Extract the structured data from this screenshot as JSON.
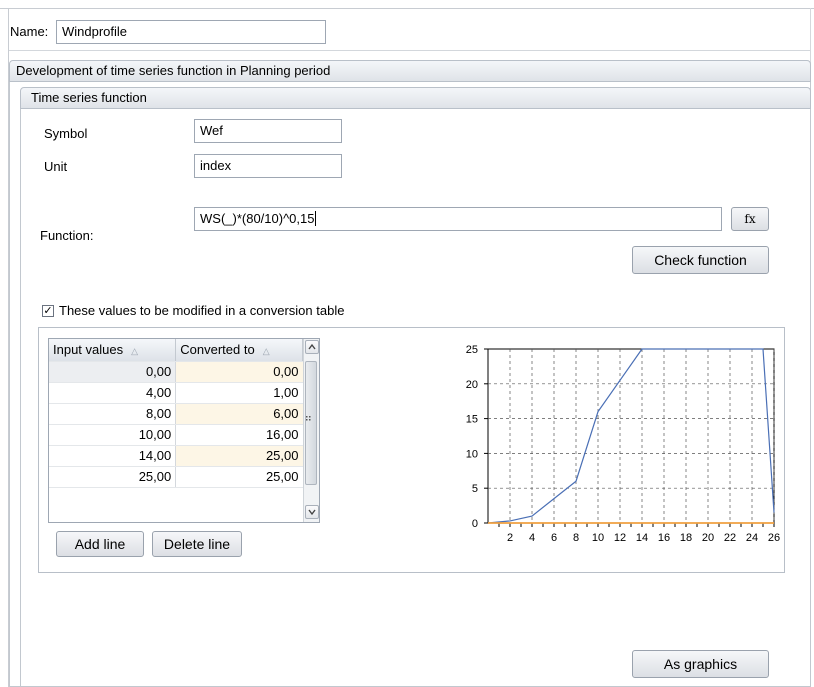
{
  "name": {
    "label": "Name:",
    "value": "Windprofile"
  },
  "dev_section": {
    "title": "Development of time series function in Planning period"
  },
  "ts_section": {
    "title": "Time series function"
  },
  "fields": {
    "symbol_label": "Symbol",
    "symbol_value": "Wef",
    "unit_label": "Unit",
    "unit_value": "index",
    "function_label": "Function:",
    "function_value": "WS(_)*(80/10)^0,15"
  },
  "buttons": {
    "fx": "fx",
    "check_function": "Check function",
    "add_line": "Add line",
    "delete_line": "Delete line",
    "as_graphics": "As graphics"
  },
  "checkbox": {
    "label": "These values to be modified in a conversion table",
    "checked": true,
    "mark": "✓"
  },
  "table": {
    "columns": [
      "Input values",
      "Converted to"
    ],
    "sort_glyph": "△",
    "rows": [
      [
        "0,00",
        "0,00"
      ],
      [
        "4,00",
        "1,00"
      ],
      [
        "8,00",
        "6,00"
      ],
      [
        "10,00",
        "16,00"
      ],
      [
        "14,00",
        "25,00"
      ],
      [
        "25,00",
        "25,00"
      ]
    ]
  },
  "icons": {
    "scroll_up": "scroll-up-icon",
    "scroll_down": "scroll-down-icon",
    "resize_grip": "resize-grip-icon"
  },
  "colors": {
    "series_line": "#4a6fb5",
    "baseline": "#f0a040",
    "grid": "#555555"
  },
  "chart_data": {
    "type": "line",
    "title": "",
    "xlabel": "",
    "ylabel": "",
    "xlim": [
      0,
      26
    ],
    "ylim": [
      0,
      25
    ],
    "xticks": [
      2,
      4,
      6,
      8,
      10,
      12,
      14,
      16,
      18,
      20,
      22,
      24,
      26
    ],
    "yticks": [
      0,
      5,
      10,
      15,
      20,
      25
    ],
    "grid": true,
    "series": [
      {
        "x": [
          0,
          2,
          4,
          6,
          8,
          10,
          12,
          14,
          16,
          18,
          20,
          22,
          24,
          25,
          26
        ],
        "y": [
          0,
          0.3,
          1,
          3.5,
          6,
          16,
          20.5,
          25,
          25,
          25,
          25,
          25,
          25,
          25,
          1.5
        ]
      },
      {
        "x": [
          0,
          26
        ],
        "y": [
          0,
          0
        ]
      }
    ]
  }
}
